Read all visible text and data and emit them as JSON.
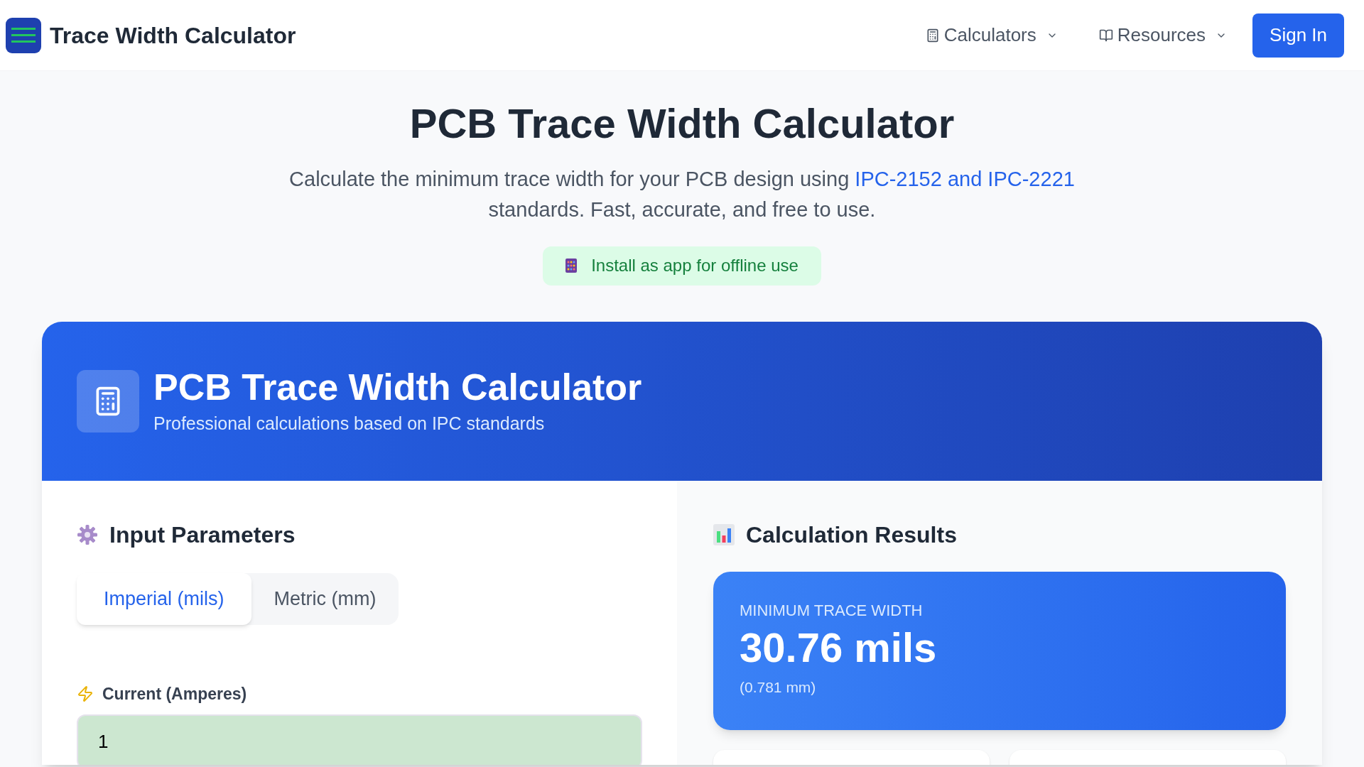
{
  "header": {
    "brand": "Trace Width Calculator",
    "nav": [
      {
        "label": "Calculators",
        "kind": "calculator"
      },
      {
        "label": "Resources",
        "kind": "book"
      }
    ],
    "sign_in": "Sign In"
  },
  "hero": {
    "title": "PCB Trace Width Calculator",
    "subtitle_before": "Calculate the minimum trace width for your PCB design using ",
    "subtitle_link": "IPC-2152 and IPC-2221",
    "subtitle_after": " standards. Fast, accurate, and free to use.",
    "install": "Install as app for offline use"
  },
  "card": {
    "title": "PCB Trace Width Calculator",
    "subtitle": "Professional calculations based on IPC standards"
  },
  "inputs": {
    "title": "Input Parameters",
    "units": [
      {
        "label": "Imperial (mils)",
        "selected": true
      },
      {
        "label": "Metric (mm)",
        "selected": false
      }
    ],
    "current": {
      "label": "Current (Amperes)",
      "value": "1"
    }
  },
  "results": {
    "title": "Calculation Results",
    "label": "MINIMUM TRACE WIDTH",
    "value": "30.76 mils",
    "secondary": "(0.781 mm)"
  }
}
